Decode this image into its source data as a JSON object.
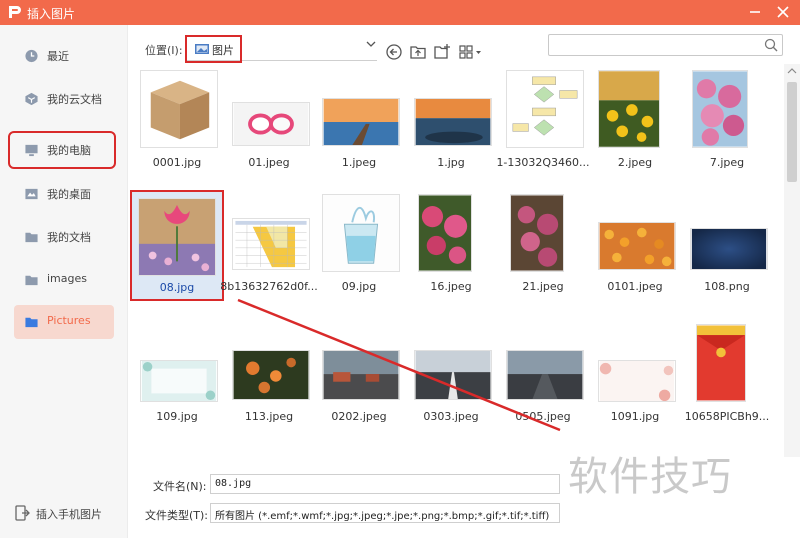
{
  "window": {
    "title": "插入图片"
  },
  "sidebar": {
    "items": [
      {
        "label": "最近",
        "icon": "clock-icon"
      },
      {
        "label": "我的云文档",
        "icon": "cloud-doc-icon"
      },
      {
        "label": "我的电脑",
        "icon": "computer-icon"
      },
      {
        "label": "我的桌面",
        "icon": "desktop-icon"
      },
      {
        "label": "我的文档",
        "icon": "folder-icon"
      },
      {
        "label": "images",
        "icon": "folder-icon"
      },
      {
        "label": "Pictures",
        "icon": "folder-icon"
      }
    ],
    "active": "Pictures",
    "bottom_label": "插入手机图片"
  },
  "toolbar": {
    "location_label": "位置(I):",
    "location_value": "图片",
    "search_placeholder": ""
  },
  "files": [
    {
      "name": "0001.jpg",
      "thumb": "box"
    },
    {
      "name": "01.jpeg",
      "thumb": "dragonfruit"
    },
    {
      "name": "1.jpeg",
      "thumb": "pier"
    },
    {
      "name": "1.jpg",
      "thumb": "sunset-sea"
    },
    {
      "name": "1-13032Q3460...",
      "thumb": "flowchart"
    },
    {
      "name": "2.jpeg",
      "thumb": "yellow-flowers"
    },
    {
      "name": "7.jpeg",
      "thumb": "pink-blossoms"
    },
    {
      "name": "08.jpg",
      "thumb": "tulip"
    },
    {
      "name": "8b13632762d0f...",
      "thumb": "spreadsheet"
    },
    {
      "name": "09.jpg",
      "thumb": "water-glass"
    },
    {
      "name": "16.jpeg",
      "thumb": "pink-flowers"
    },
    {
      "name": "21.jpeg",
      "thumb": "pink-flowers-2"
    },
    {
      "name": "0101.jpeg",
      "thumb": "orange-field"
    },
    {
      "name": "108.png",
      "thumb": "dark-blue"
    },
    {
      "name": "109.jpg",
      "thumb": "light-frame"
    },
    {
      "name": "113.jpeg",
      "thumb": "green-bokeh"
    },
    {
      "name": "0202.jpeg",
      "thumb": "road-cars"
    },
    {
      "name": "0303.jpeg",
      "thumb": "road"
    },
    {
      "name": "0505.jpeg",
      "thumb": "road-2"
    },
    {
      "name": "1091.jpg",
      "thumb": "floral-frame"
    },
    {
      "name": "10658PICBh9...",
      "thumb": "red-packet"
    }
  ],
  "selected_file": "08.jpg",
  "form": {
    "filename_label": "文件名(N):",
    "filename_value": "08.jpg",
    "filetype_label": "文件类型(T):",
    "filetype_value": "所有图片 (*.emf;*.wmf;*.jpg;*.jpeg;*.jpe;*.png;*.bmp;*.gif;*.tif;*.tiff)"
  },
  "watermark": "软件技巧",
  "colors": {
    "accent": "#f26a4b",
    "annotation": "#d92a2a"
  }
}
